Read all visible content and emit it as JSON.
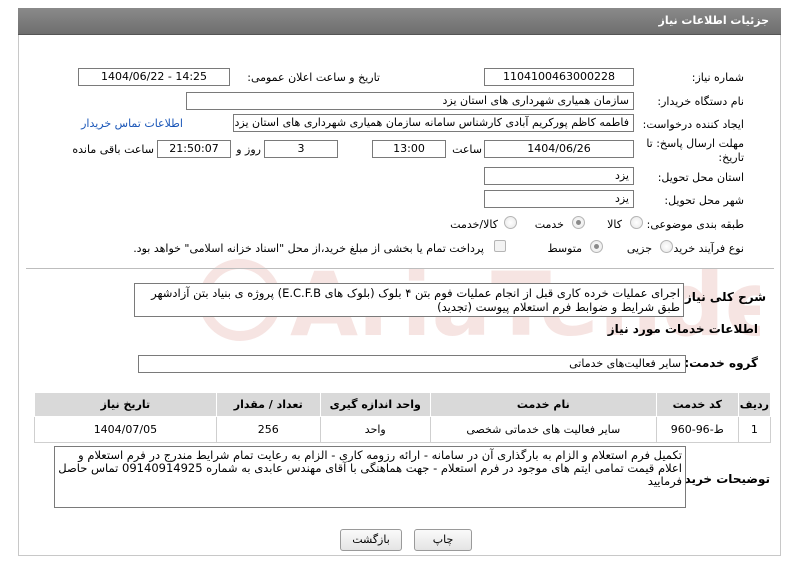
{
  "header": {
    "title": "جزئیات اطلاعات نیاز"
  },
  "labels": {
    "need_number": "شماره نیاز:",
    "announce_datetime": "تاریخ و ساعت اعلان عمومی:",
    "buyer_org": "نام دستگاه خریدار:",
    "request_creator": "ایجاد کننده درخواست:",
    "buyer_contact_link": "اطلاعات تماس خریدار",
    "deadline": "مهلت ارسال پاسخ: تا تاریخ:",
    "time_word": "ساعت",
    "day_and": "روز و",
    "remaining_time": "ساعت باقی مانده",
    "delivery_province": "استان محل تحویل:",
    "delivery_city": "شهر محل تحویل:",
    "subject_category": "طبقه بندی موضوعی:",
    "purchase_process": "نوع فرآیند خرید :",
    "need_description": "شرح کلی نیاز:",
    "services_info": "اطلاعات خدمات مورد نیاز",
    "service_group": "گروه خدمت:",
    "buyer_notes": "توضیحات خریدار:"
  },
  "values": {
    "need_number": "1104100463000228",
    "announce_datetime": "1404/06/22 - 14:25",
    "buyer_org": "سازمان همیاری شهرداری های استان یزد",
    "request_creator": "فاطمه کاظم پورکریم آبادی کارشناس سامانه سازمان همیاری شهرداری های استان یزد",
    "deadline_date": "1404/06/26",
    "deadline_time": "13:00",
    "remaining_days": "3",
    "remaining_clock": "21:50:07",
    "delivery_province": "یزد",
    "delivery_city": "یزد",
    "need_description": "اجرای عملیات خرده کاری قبل از انجام عملیات فوم بتن ۴ بلوک (بلوک های E.C.F.B) پروژه ی بنیاد بتن آزادشهر طبق شرایط و ضوابط فرم استعلام پیوست (تجدید)",
    "service_group": "سایر فعالیت‌های خدماتی",
    "buyer_notes": "تکمیل فرم استعلام و الزام به بارگذاری آن در سامانه - ارائه رزومه کاری - الزام به رعایت تمام شرایط مندرج در فرم استعلام و اعلام قیمت تمامی ایتم های موجود در فرم استعلام - جهت هماهنگی با آقای مهندس عابدی به شماره 09140914925 تماس حاصل فرمایید"
  },
  "category_options": [
    {
      "label": "کالا",
      "selected": false
    },
    {
      "label": "خدمت",
      "selected": true
    },
    {
      "label": "کالا/خدمت",
      "selected": false
    }
  ],
  "process_options": [
    {
      "label": "جزیی",
      "selected": false
    },
    {
      "label": "متوسط",
      "selected": true
    }
  ],
  "payment_note": "پرداخت تمام یا بخشی از مبلغ خرید،از محل \"اسناد خزانه اسلامی\" خواهد بود.",
  "table": {
    "headers": [
      "ردیف",
      "کد خدمت",
      "نام خدمت",
      "واحد اندازه گیری",
      "تعداد / مقدار",
      "تاریخ نیاز"
    ],
    "rows": [
      [
        "1",
        "ط-96-960",
        "سایر فعالیت های خدماتی شخصی",
        "واحد",
        "256",
        "1404/07/05"
      ]
    ]
  },
  "buttons": {
    "print": "چاپ",
    "back": "بازگشت"
  },
  "watermark": {
    "text": "AriaTender.net"
  }
}
